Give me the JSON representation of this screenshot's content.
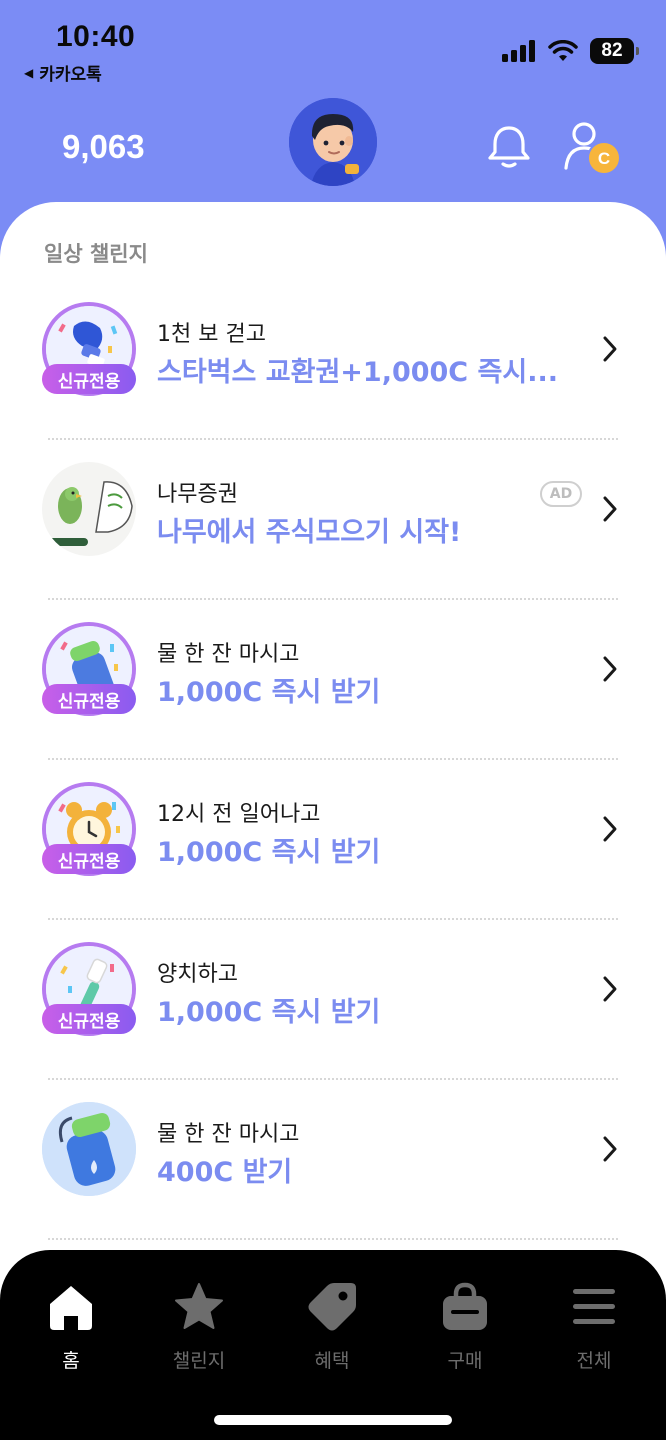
{
  "status_bar": {
    "time": "10:40",
    "back_app": "카카오톡",
    "battery": "82"
  },
  "header": {
    "points": "9,063",
    "coin_symbol": "C"
  },
  "section": {
    "title": "일상 챌린지"
  },
  "challenges": [
    {
      "title": "1천 보 걷고",
      "subtitle": "스타벅스 교환권+1,000C 즉시...",
      "badge": "신규전용",
      "icon": "boxing-glove-icon"
    },
    {
      "title": "나무증권",
      "subtitle": "나무에서 주식모으기 시작!",
      "ad": "AD",
      "icon": "parrot-cartoon-icon"
    },
    {
      "title": "물 한 잔 마시고",
      "subtitle": "1,000C 즉시 받기",
      "badge": "신규전용",
      "icon": "water-bottle-icon"
    },
    {
      "title": "12시 전 일어나고",
      "subtitle": "1,000C 즉시 받기",
      "badge": "신규전용",
      "icon": "alarm-clock-icon"
    },
    {
      "title": "양치하고",
      "subtitle": "1,000C 즉시 받기",
      "badge": "신규전용",
      "icon": "toothbrush-icon"
    },
    {
      "title": "물 한 잔 마시고",
      "subtitle": "400C 받기",
      "icon": "water-bottle-icon"
    }
  ],
  "nav": {
    "items": [
      {
        "label": "홈",
        "icon": "home-icon",
        "active": true
      },
      {
        "label": "챌린지",
        "icon": "star-icon"
      },
      {
        "label": "혜택",
        "icon": "tag-icon"
      },
      {
        "label": "구매",
        "icon": "shopping-bag-icon"
      },
      {
        "label": "전체",
        "icon": "menu-icon"
      }
    ]
  },
  "colors": {
    "header_bg": "#7B8CF5",
    "accent_text": "#7B8CF0",
    "badge_gradient_start": "#C85FE8",
    "badge_gradient_end": "#8A5CF0",
    "coin": "#F7B53B"
  }
}
